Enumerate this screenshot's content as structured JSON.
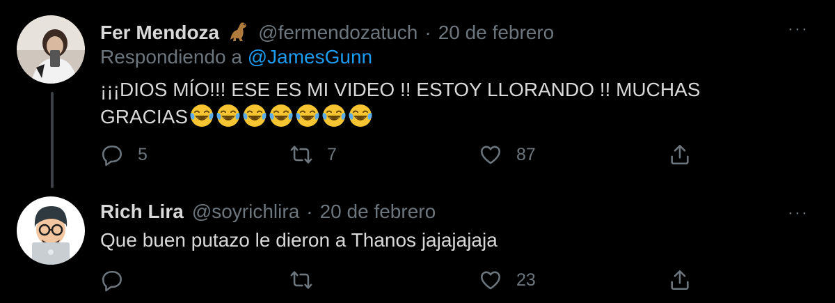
{
  "tweets": [
    {
      "name": "Fer Mendoza",
      "handle": "@fermendozatuch",
      "separator": "·",
      "date": "20 de febrero",
      "replying_prefix": "Respondiendo a",
      "replying_to": "@JamesGunn",
      "text_line1": "¡¡¡DIOS MÍO!!! ESE ES MI VIDEO !! ESTOY LLORANDO !! MUCHAS",
      "text_line2": "GRACIAS",
      "emoji_count": 7,
      "more": "···",
      "replies": "5",
      "retweets": "7",
      "likes": "87"
    },
    {
      "name": "Rich Lira",
      "handle": "@soyrichlira",
      "separator": "·",
      "date": "20 de febrero",
      "text": "Que buen putazo le dieron a Thanos jajajajaja",
      "more": "···",
      "replies": "",
      "retweets": "",
      "likes": "23"
    }
  ],
  "icons": {
    "reply": "reply-icon",
    "retweet": "retweet-icon",
    "like": "heart-icon",
    "share": "share-icon",
    "more": "more-icon"
  },
  "colors": {
    "background": "#000000",
    "text": "#d9d9d9",
    "secondary": "#6e767d",
    "mention": "#1d9bf0"
  }
}
